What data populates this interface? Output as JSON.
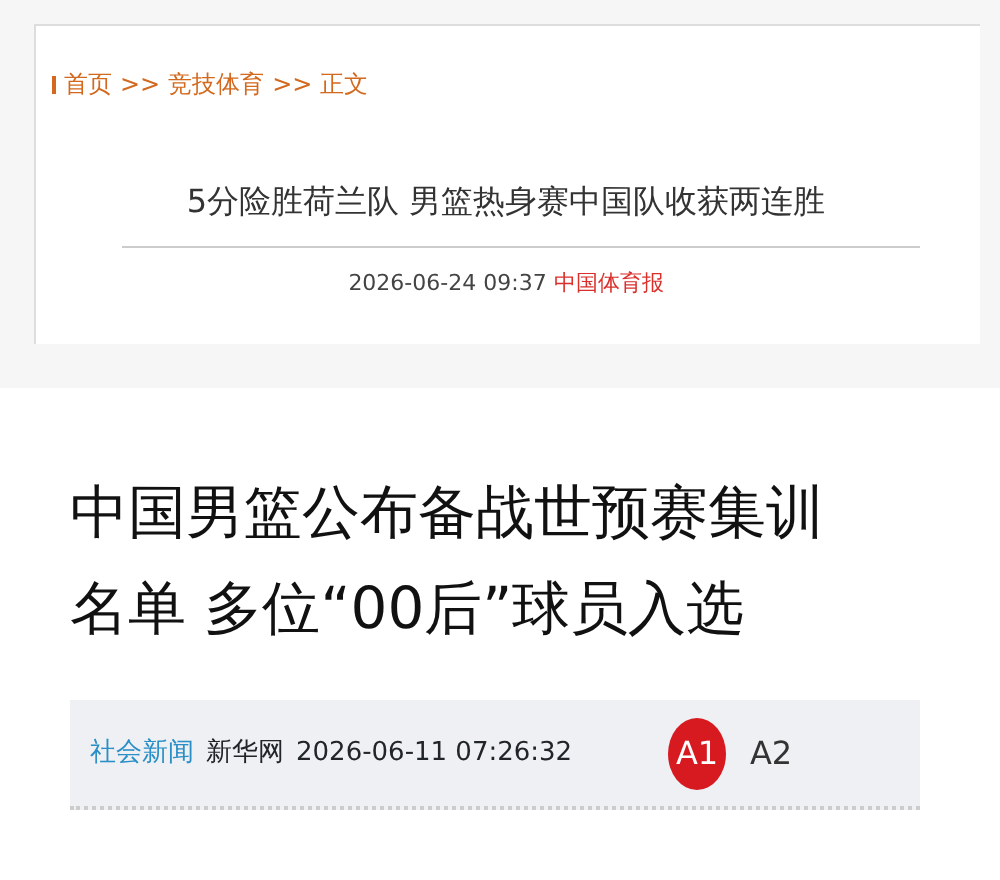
{
  "top_article": {
    "breadcrumb": [
      {
        "label": "首页"
      },
      {
        "label": "竞技体育"
      },
      {
        "label": "正文"
      }
    ],
    "separator": ">>",
    "title": "5分险胜荷兰队  男篮热身赛中国队收获两连胜",
    "date": "2026-06-24 09:37",
    "source": "中国体育报"
  },
  "bottom_article": {
    "title": "中国男篮公布备战世预赛集训名单 多位“00后”球员入选",
    "category": "社会新闻",
    "source": "新华网",
    "date": "2026-06-11 07:26:32",
    "font_sizes": [
      {
        "label": "A1",
        "selected": true
      },
      {
        "label": "A2",
        "selected": false
      }
    ]
  }
}
